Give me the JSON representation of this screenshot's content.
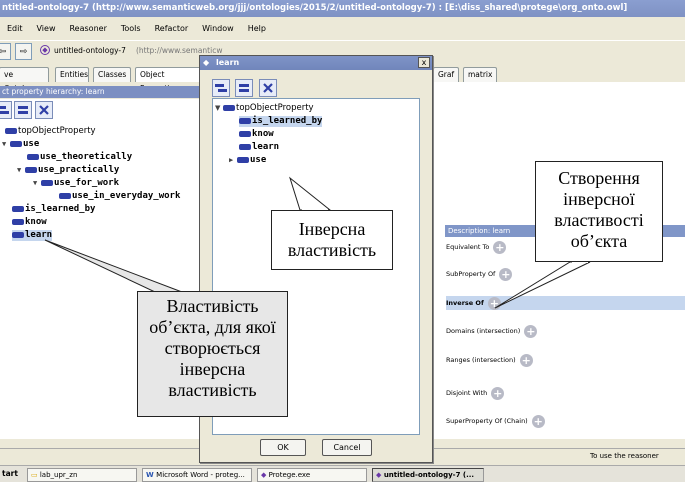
{
  "window": {
    "title": "ntitled-ontology-7 (http://www.semanticweb.org/jjj/ontologies/2015/2/untitled-ontology-7) : [E:\\diss_shared\\protege\\org_onto.owl]"
  },
  "menu": [
    "Edit",
    "View",
    "Reasoner",
    "Tools",
    "Refactor",
    "Window",
    "Help"
  ],
  "address": {
    "ontology": "untitled-ontology-7",
    "url": "(http://www.semanticw"
  },
  "tabs": [
    "ve Ontology",
    "Entities",
    "Classes",
    "Object Properties"
  ],
  "tabs_right": [
    "Graf",
    "matrix"
  ],
  "hierarchy": {
    "header": "ct property hierarchy: learn",
    "nodes": [
      {
        "label": "topObjectProperty"
      },
      {
        "label": "use"
      },
      {
        "label": "use_theoretically"
      },
      {
        "label": "use_practically"
      },
      {
        "label": "use_for_work"
      },
      {
        "label": "use_in_everyday_work"
      },
      {
        "label": "is_learned_by"
      },
      {
        "label": "know"
      },
      {
        "label": "learn"
      }
    ]
  },
  "description": {
    "header": "Description: learn",
    "rows": [
      "Equivalent To",
      "SubProperty Of",
      "Inverse Of",
      "Domains (intersection)",
      "Ranges (intersection)",
      "Disjoint With",
      "SuperProperty Of (Chain)"
    ]
  },
  "dialog": {
    "title": "learn",
    "close": "x",
    "nodes": [
      "topObjectProperty",
      "is_learned_by",
      "know",
      "learn",
      "use"
    ],
    "ok": "OK",
    "cancel": "Cancel"
  },
  "callouts": {
    "inverse_property": "Інверсна властивість",
    "creating_inverse": "Створення інверсної властивості об’єкта",
    "property_for_which": "Властивість об’єкта, для якої створюється інверсна властивість"
  },
  "status": {
    "text": "To use the reasoner"
  },
  "taskbar": {
    "start": "tart",
    "items": [
      "lab_upr_zn",
      "Microsoft Word - proteg...",
      "Protege.exe",
      "untitled-ontology-7 (..."
    ]
  },
  "colors": {
    "titlebar": "#7f92c4",
    "property_icon": "#2f3fa6",
    "selected": "#c5d6ee"
  }
}
